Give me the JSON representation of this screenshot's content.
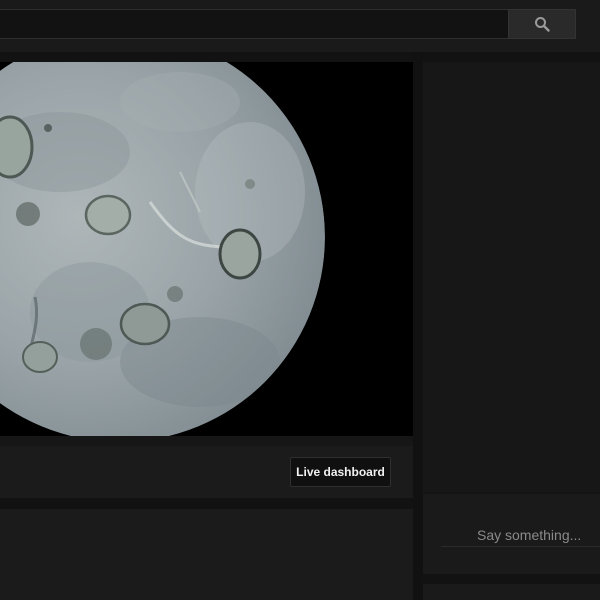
{
  "header": {
    "search_placeholder": "",
    "search_icon": "search-icon"
  },
  "player": {
    "content": "microscope-view-protozoa"
  },
  "info_bar": {
    "live_dashboard_label": "Live dashboard"
  },
  "chat": {
    "input_placeholder": "Say something..."
  },
  "colors": {
    "background": "#121212",
    "panel": "#1b1b1b",
    "button_text": "#f1f1f1",
    "placeholder_text": "#8a8a8a"
  }
}
